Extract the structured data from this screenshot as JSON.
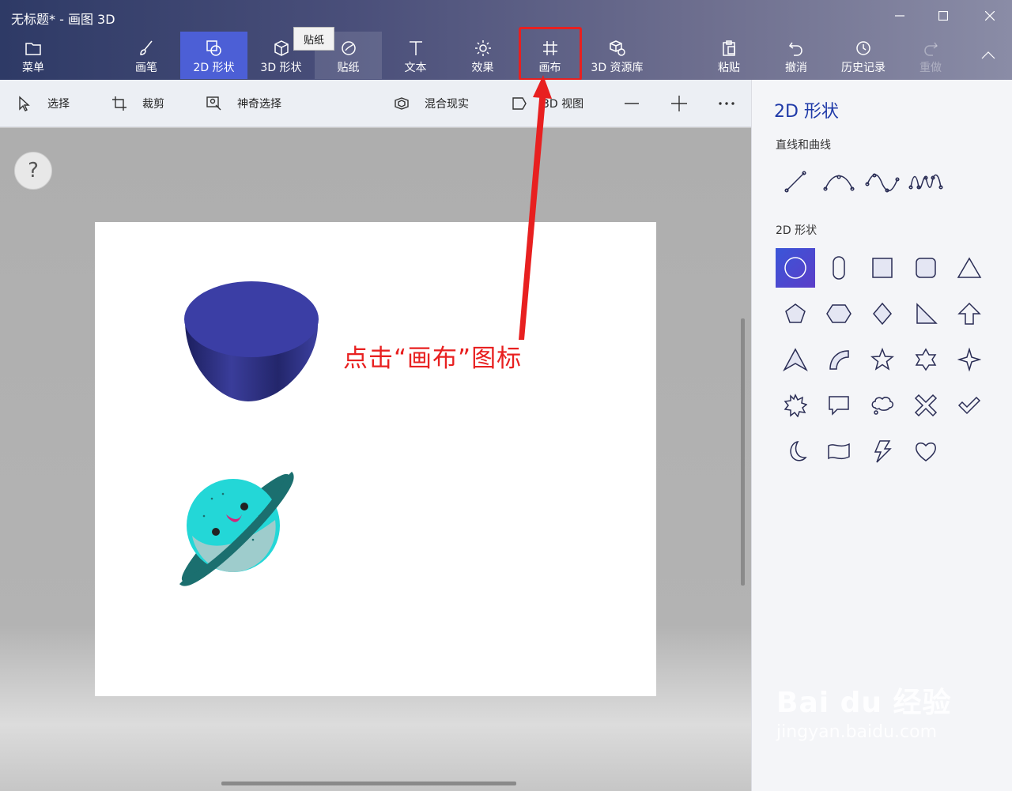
{
  "window": {
    "title": "无标题* - 画图 3D"
  },
  "ribbon": {
    "tools": [
      {
        "label": "菜单",
        "icon": "folder-icon"
      },
      {
        "label": "画笔",
        "icon": "brush-icon"
      },
      {
        "label": "2D 形状",
        "icon": "2d-shapes-icon",
        "active": true
      },
      {
        "label": "3D 形状",
        "icon": "3d-cube-icon"
      },
      {
        "label": "贴纸",
        "icon": "sticker-icon"
      },
      {
        "label": "文本",
        "icon": "text-icon"
      },
      {
        "label": "效果",
        "icon": "sun-effects-icon"
      },
      {
        "label": "画布",
        "icon": "canvas-icon"
      },
      {
        "label": "3D 资源库",
        "icon": "3d-library-icon"
      },
      {
        "label": "粘贴",
        "icon": "paste-icon"
      },
      {
        "label": "撤消",
        "icon": "undo-icon"
      },
      {
        "label": "历史记录",
        "icon": "history-icon"
      },
      {
        "label": "重做",
        "icon": "redo-icon",
        "disabled": true
      }
    ],
    "tooltip": "贴纸"
  },
  "subbar": {
    "select": "选择",
    "crop": "裁剪",
    "magic_select": "神奇选择",
    "mixed_reality": "混合现实",
    "view_3d": "3D 视图"
  },
  "workspace": {
    "help": "?",
    "annotation": "点击“画布”图标"
  },
  "panel": {
    "title": "2D 形状",
    "lines_section": "直线和曲线",
    "shapes_section": "2D 形状",
    "lines": [
      "line-icon",
      "curve-icon",
      "two-point-curve-icon",
      "three-point-curve-icon"
    ],
    "shapes": [
      "circle-icon",
      "pill-icon",
      "square-icon",
      "rounded-square-icon",
      "triangle-icon",
      "pentagon-icon",
      "hexagon-icon",
      "diamond-icon",
      "right-triangle-icon",
      "arrow-up-icon",
      "arrowhead-icon",
      "quarter-circle-icon",
      "star5-icon",
      "star6-icon",
      "star4-icon",
      "burst-icon",
      "speech-bubble-icon",
      "thought-bubble-icon",
      "cross-icon",
      "check-icon",
      "moon-icon",
      "banner-icon",
      "lightning-icon",
      "heart-icon"
    ]
  },
  "watermark": {
    "brand": "Bai du 经验",
    "url": "jingyan.baidu.com"
  },
  "colors": {
    "accent": "#4c5fd6",
    "annotation": "#e82020",
    "panel_title": "#1f3aa8"
  }
}
